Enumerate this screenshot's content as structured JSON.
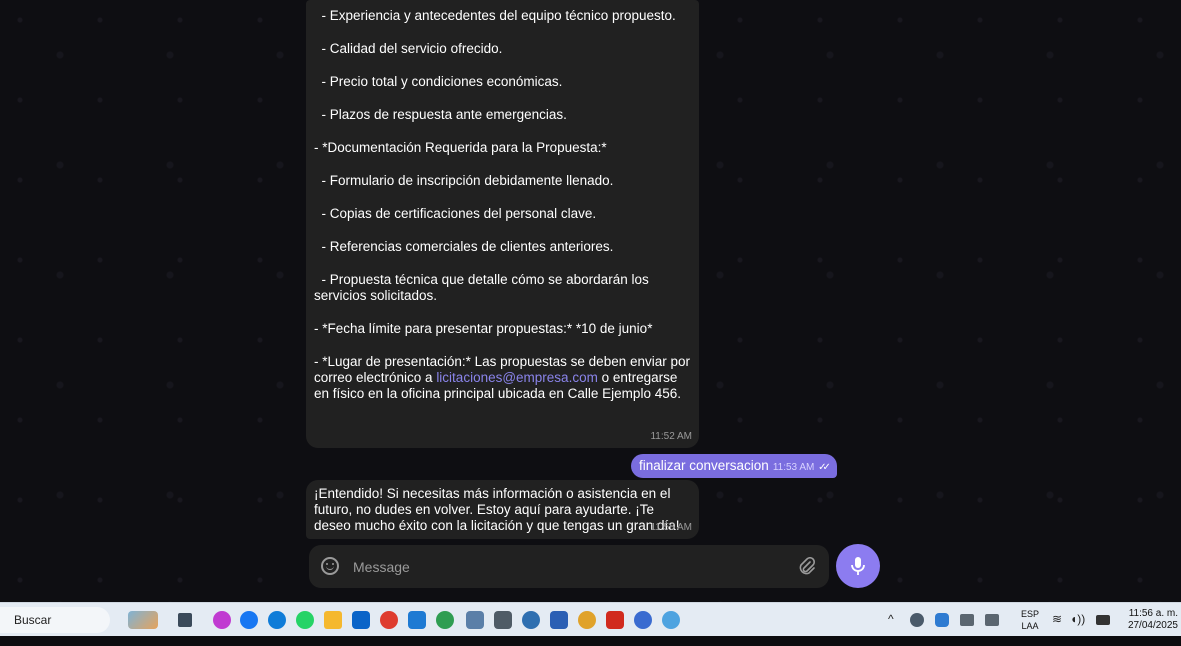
{
  "chat": {
    "message1": {
      "lines": [
        "- Experiencia y antecedentes del equipo técnico propuesto.",
        "- Calidad del servicio ofrecido.",
        "- Precio total y condiciones económicas.",
        "- Plazos de respuesta ante emergencias.",
        "- *Documentación Requerida para la Propuesta:*",
        "- Formulario de inscripción debidamente llenado.",
        "- Copias de certificaciones del personal clave.",
        "- Referencias comerciales de clientes anteriores.",
        "- Propuesta técnica que detalle cómo se abordarán los servicios solicitados.",
        "- *Fecha límite para presentar propuestas:* *10 de junio*"
      ],
      "last_line_before_link": "- *Lugar de presentación:* Las propuestas se deben enviar por correo electrónico a ",
      "link": "licitaciones@empresa.com",
      "last_line_after_link": " o entregarse en físico en la oficina principal ubicada en Calle Ejemplo 456.",
      "time": "11:52 AM"
    },
    "outgoing": {
      "text": "finalizar conversacion",
      "time": "11:53 AM"
    },
    "message2": {
      "text": "¡Entendido! Si necesitas más información o asistencia en el futuro, no dudes en volver. Estoy aquí para ayudarte. ¡Te deseo mucho éxito con la licitación y que tengas un gran día!",
      "time": "11:56 AM"
    }
  },
  "composer": {
    "placeholder": "Message",
    "emoji_icon": "smiley-icon",
    "attach_icon": "paperclip-icon",
    "mic_icon": "microphone-icon"
  },
  "taskbar": {
    "search_label": "Buscar",
    "language": [
      "ESP",
      "LAA"
    ],
    "time": "11:56 a. m.",
    "date": "27/04/2025"
  },
  "colors": {
    "accent": "#8c7cf0",
    "incoming_bubble": "#212121",
    "outgoing_bubble": "#7a6ddf",
    "link": "#8a84ea"
  }
}
